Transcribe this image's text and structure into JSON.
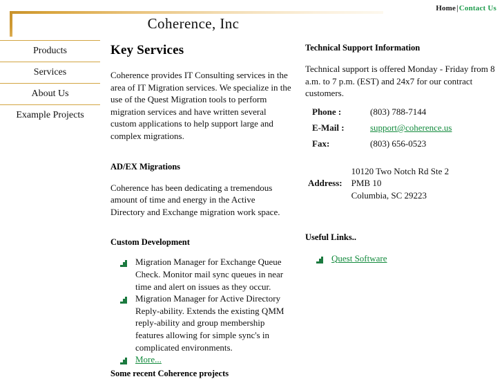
{
  "header": {
    "site_title": "Coherence, Inc",
    "nav": {
      "home_label": "Home",
      "separator": "|",
      "contact_label": "Contact Us"
    },
    "colors": {
      "rule_gold": "#c8922c",
      "link_green": "#128a3c",
      "bullet_green": "#1b7a3f"
    }
  },
  "sidebar": {
    "items": [
      {
        "label": "Products"
      },
      {
        "label": "Services"
      },
      {
        "label": "About Us"
      },
      {
        "label": "Example Projects"
      }
    ]
  },
  "main": {
    "heading": "Key Services",
    "intro": "Coherence provides IT Consulting services in the area of IT Migration services.  We specialize in the use of the Quest Migration tools to perform migration services and have written several custom applications to help support large and complex migrations.",
    "adex_heading": "AD/EX Migrations",
    "adex_text": "Coherence has been dedicating a tremendous amount of time and energy in the Active Directory and Exchange migration work space.",
    "custom_dev_heading": "Custom Development",
    "custom_dev_items": [
      {
        "text": "Migration Manager for Exchange Queue Check.  Monitor mail sync queues in near time and alert on issues as they occur.",
        "is_link": false
      },
      {
        "text": "Migration Manager for Active Directory Reply-ability.  Extends the existing QMM reply-ability and group membership features allowing for simple sync's in complicated environments.",
        "is_link": false
      },
      {
        "text": "More...",
        "is_link": true
      }
    ],
    "bottom_teaser": "Some recent Coherence projects"
  },
  "right": {
    "support_heading": "Technical Support Information",
    "support_text": "Technical support is offered Monday - Friday from 8 a.m. to 7 p.m. (EST) and 24x7 for our contract customers.",
    "contact_rows": [
      {
        "label": "Phone :",
        "value": "(803) 788-7144",
        "is_link": false
      },
      {
        "label": "E-Mail :",
        "value": "support@coherence.us",
        "is_link": true
      },
      {
        "label": "Fax:",
        "value": "(803) 656-0523",
        "is_link": false
      }
    ],
    "address_label": "Address:",
    "address_lines": [
      "10120 Two Notch Rd Ste 2",
      "PMB 10",
      "Columbia, SC 29223"
    ],
    "links_heading": "Useful Links..",
    "links": [
      {
        "label": "Quest Software"
      }
    ]
  }
}
